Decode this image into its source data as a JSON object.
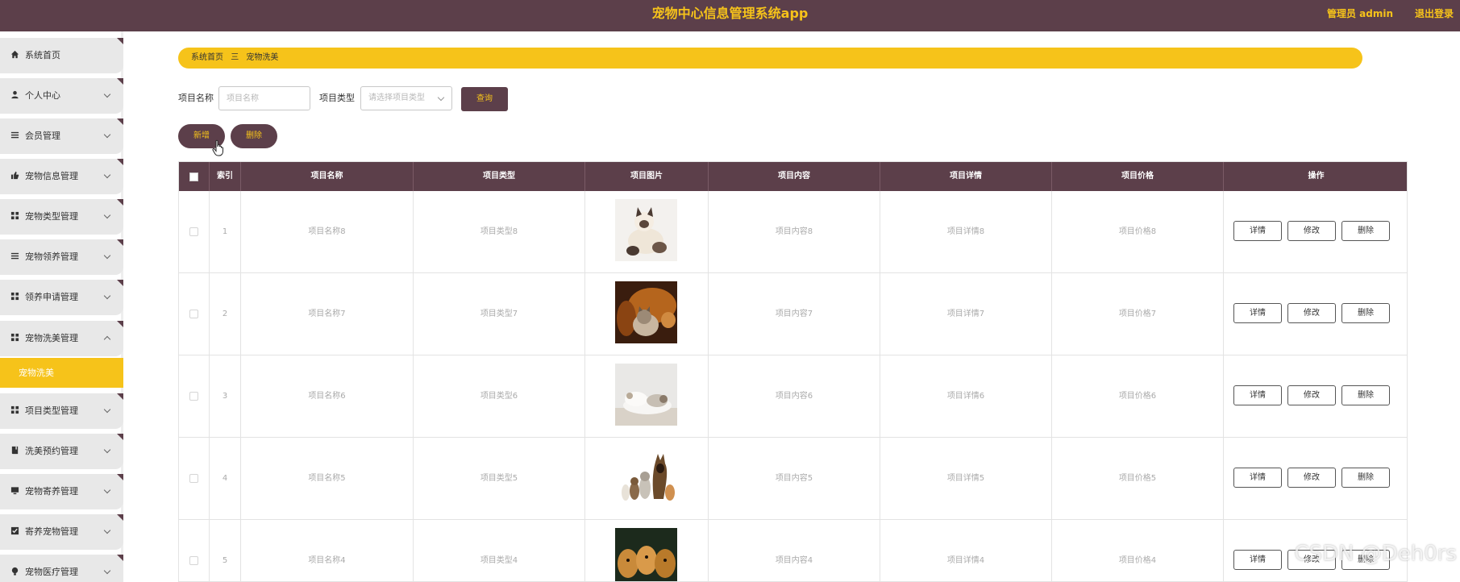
{
  "header": {
    "title": "宠物中心信息管理系统app",
    "user": "管理员 admin",
    "logout": "退出登录"
  },
  "sidebar": {
    "items": [
      {
        "label": "系统首页",
        "icon": "home-icon"
      },
      {
        "label": "个人中心",
        "icon": "user-icon"
      },
      {
        "label": "会员管理",
        "icon": "list-icon"
      },
      {
        "label": "宠物信息管理",
        "icon": "thumbs-up-icon"
      },
      {
        "label": "宠物类型管理",
        "icon": "grid-icon"
      },
      {
        "label": "宠物领养管理",
        "icon": "list-icon"
      },
      {
        "label": "领养申请管理",
        "icon": "grid-icon"
      },
      {
        "label": "宠物洗美管理",
        "icon": "grid-icon"
      },
      {
        "label": "项目类型管理",
        "icon": "grid-icon"
      },
      {
        "label": "洗美预约管理",
        "icon": "book-icon"
      },
      {
        "label": "宠物寄养管理",
        "icon": "monitor-icon"
      },
      {
        "label": "寄养宠物管理",
        "icon": "checkbox-icon"
      },
      {
        "label": "宠物医疗管理",
        "icon": "bulb-icon"
      }
    ],
    "active_sub": "宠物洗美"
  },
  "breadcrumb": {
    "home": "系统首页",
    "separator": "三",
    "current": "宠物洗美"
  },
  "search": {
    "name_label": "项目名称",
    "name_placeholder": "项目名称",
    "type_label": "项目类型",
    "type_placeholder": "请选择项目类型",
    "query_button": "查询"
  },
  "actions": {
    "add": "新增",
    "delete": "删除"
  },
  "table": {
    "columns": [
      "索引",
      "项目名称",
      "项目类型",
      "项目图片",
      "项目内容",
      "项目详情",
      "项目价格",
      "操作"
    ],
    "rows": [
      {
        "index": "1",
        "name": "项目名称8",
        "type": "项目类型8",
        "content": "项目内容8",
        "detail": "项目详情8",
        "price": "项目价格8",
        "image": "cat-with-kitten"
      },
      {
        "index": "2",
        "name": "项目名称7",
        "type": "项目类型7",
        "content": "项目内容7",
        "detail": "项目详情7",
        "price": "项目价格7",
        "image": "kitten-with-dog"
      },
      {
        "index": "3",
        "name": "项目名称6",
        "type": "项目类型6",
        "content": "项目内容6",
        "detail": "项目详情6",
        "price": "项目价格6",
        "image": "sleeping-cats"
      },
      {
        "index": "4",
        "name": "项目名称5",
        "type": "项目类型5",
        "content": "项目内容5",
        "detail": "项目详情5",
        "price": "项目价格5",
        "image": "cats-and-dogs"
      },
      {
        "index": "5",
        "name": "项目名称4",
        "type": "项目类型4",
        "content": "项目内容4",
        "detail": "项目详情4",
        "price": "项目价格4",
        "image": "golden-puppies"
      }
    ],
    "row_actions": {
      "detail": "详情",
      "edit": "修改",
      "delete": "删除"
    }
  },
  "watermark": "CSDN @Deh0rs",
  "colors": {
    "brand_dark": "#5c3f4a",
    "accent": "#f6c31a"
  }
}
